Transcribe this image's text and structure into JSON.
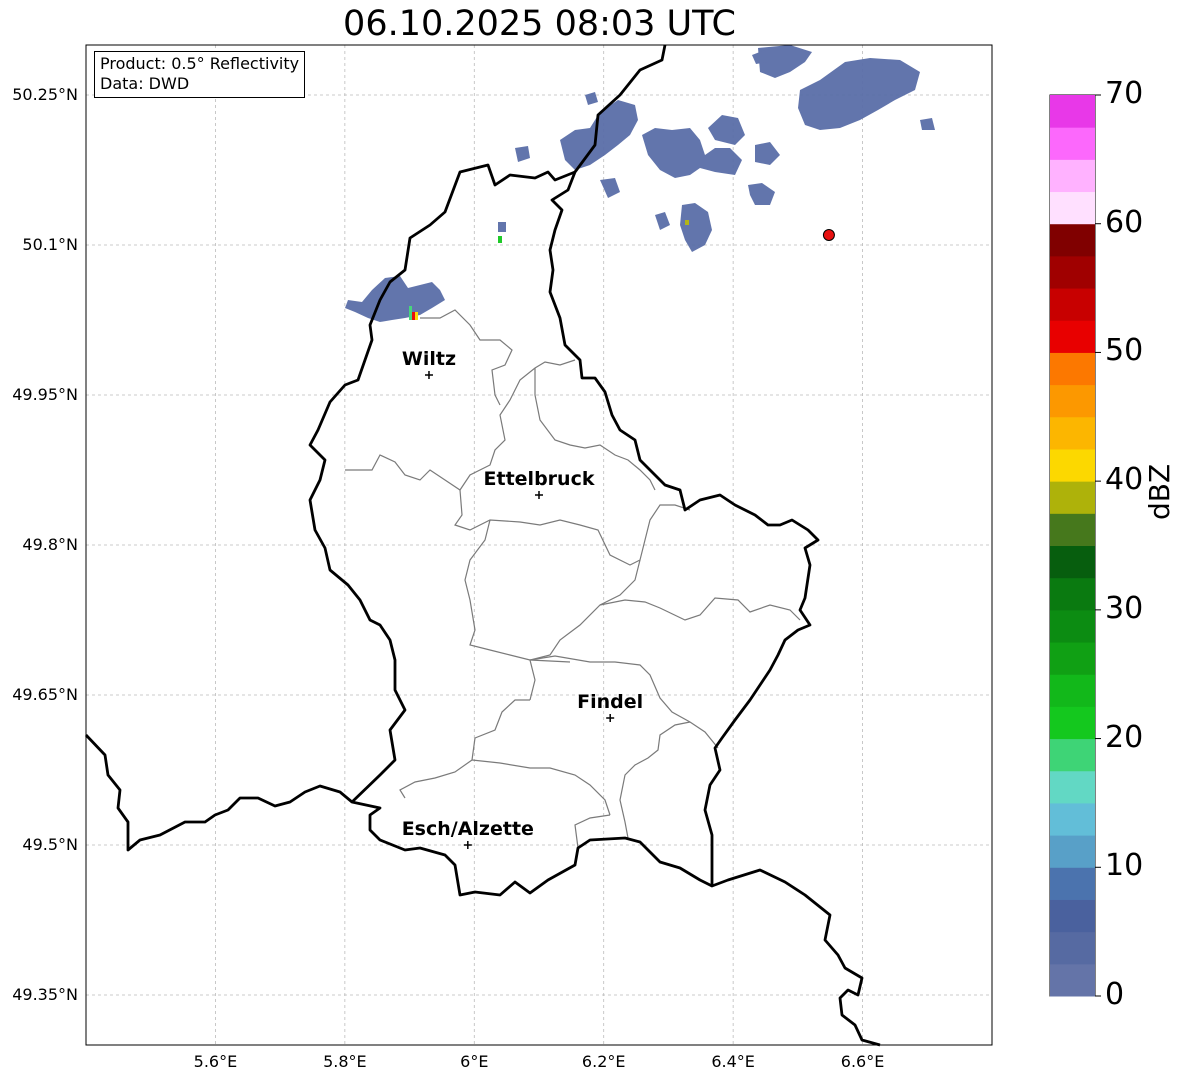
{
  "title": "06.10.2025 08:03 UTC",
  "info": {
    "product": "Product: 0.5° Reflectivity",
    "source": "Data: DWD"
  },
  "lat_labels": [
    {
      "value": 50.25,
      "label": "50.25°N"
    },
    {
      "value": 50.1,
      "label": "50.1°N"
    },
    {
      "value": 49.95,
      "label": "49.95°N"
    },
    {
      "value": 49.8,
      "label": "49.8°N"
    },
    {
      "value": 49.65,
      "label": "49.65°N"
    },
    {
      "value": 49.5,
      "label": "49.5°N"
    },
    {
      "value": 49.35,
      "label": "49.35°N"
    }
  ],
  "lon_labels": [
    {
      "value": 5.6,
      "label": "5.6°E"
    },
    {
      "value": 5.8,
      "label": "5.8°E"
    },
    {
      "value": 6.0,
      "label": "6°E"
    },
    {
      "value": 6.2,
      "label": "6.2°E"
    },
    {
      "value": 6.4,
      "label": "6.4°E"
    },
    {
      "value": 6.6,
      "label": "6.6°E"
    }
  ],
  "extent": {
    "lon_min": 5.4,
    "lon_max": 6.8,
    "lat_min": 49.3,
    "lat_max": 50.3
  },
  "cities": [
    {
      "name": "Wiltz",
      "lon": 5.93,
      "lat": 49.97
    },
    {
      "name": "Ettelbruck",
      "lon": 6.1,
      "lat": 49.85
    },
    {
      "name": "Findel",
      "lon": 6.21,
      "lat": 49.627
    },
    {
      "name": "Esch/Alzette",
      "lon": 5.99,
      "lat": 49.5
    }
  ],
  "radar_site": {
    "lon": 6.548,
    "lat": 50.11,
    "color": "#e81010"
  },
  "colorbar": {
    "label": "dBZ",
    "min": 0,
    "max": 70,
    "step": 2.5,
    "ticks": [
      0,
      10,
      20,
      30,
      40,
      50,
      60,
      70
    ],
    "colors": [
      "#6474a8",
      "#566aa2",
      "#4a619e",
      "#4b73ae",
      "#58a0c8",
      "#62bed8",
      "#62d8c4",
      "#3ed476",
      "#14c81e",
      "#12b81a",
      "#10a014",
      "#0c8c12",
      "#0a7a10",
      "#075e0e",
      "#46781c",
      "#aeb20a",
      "#fcd800",
      "#fcb600",
      "#fc9800",
      "#fc7800",
      "#e80000",
      "#c80000",
      "#a00000",
      "#800000",
      "#ffe0ff",
      "#ffb2ff",
      "#fc68fc",
      "#e838e8"
    ]
  }
}
